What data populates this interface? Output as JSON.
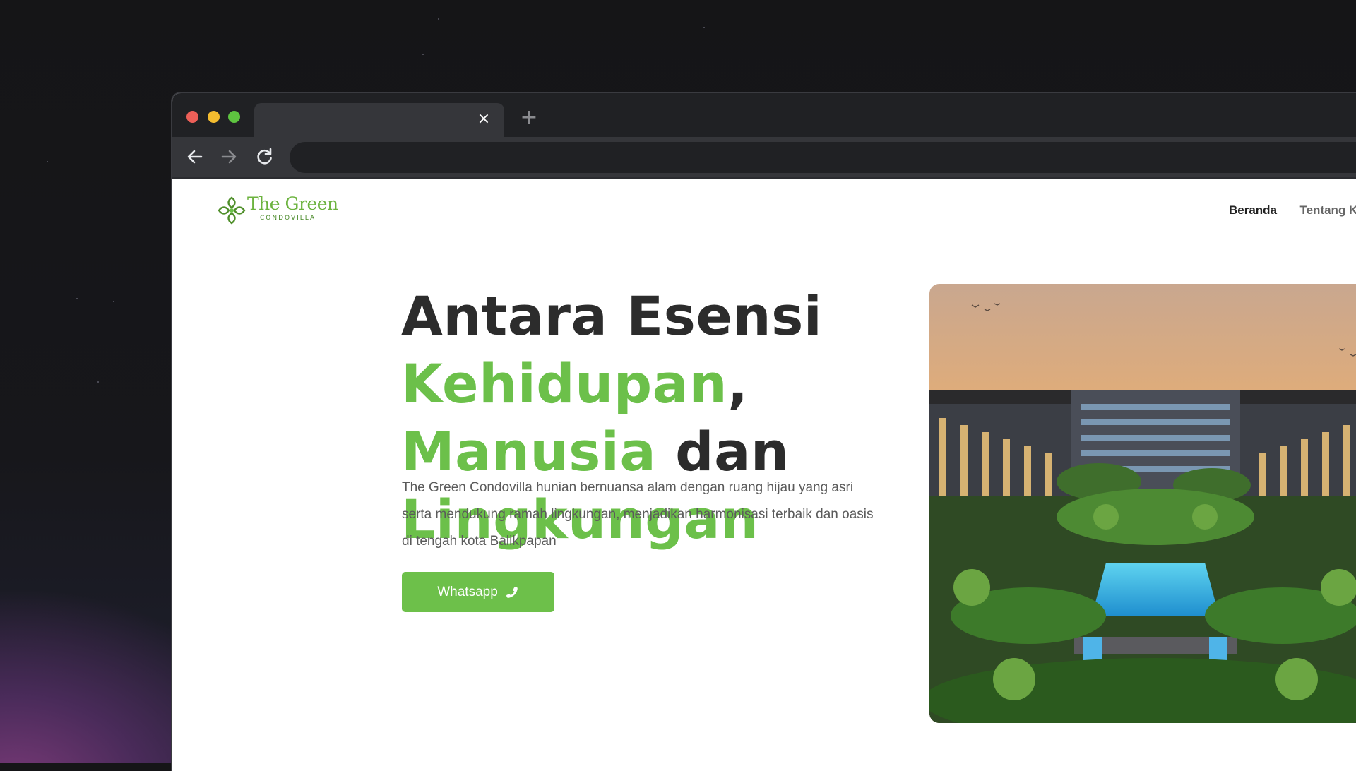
{
  "browser": {
    "tab_close_glyph": "×",
    "new_tab_glyph": "+"
  },
  "site": {
    "logo": {
      "title": "The Green",
      "subtitle": "CONDOVILLA"
    },
    "nav": [
      {
        "label": "Beranda",
        "active": true
      },
      {
        "label": "Tentang K",
        "active": false
      }
    ]
  },
  "hero": {
    "title": {
      "line1": "Antara Esensi",
      "line2_green": "Kehidupan",
      "line2_dark": ",",
      "line3_green": "Manusia",
      "line3_dark": " dan",
      "line4_green": "Lingkungan"
    },
    "description": "The Green Condovilla hunian bernuansa alam dengan ruang hijau yang asri serta mendukung ramah lingkungan, menjadikan harmonisasi terbaik dan oasis di tengah kota Balikpapan",
    "cta_label": "Whatsapp"
  },
  "colors": {
    "brand_green": "#6cc04a",
    "heading_dark": "#2c2c2c",
    "browser_chrome": "#202124"
  },
  "icons": {
    "back": "arrow-left-icon",
    "forward": "arrow-right-icon",
    "reload": "reload-icon",
    "cta": "phone-icon"
  }
}
